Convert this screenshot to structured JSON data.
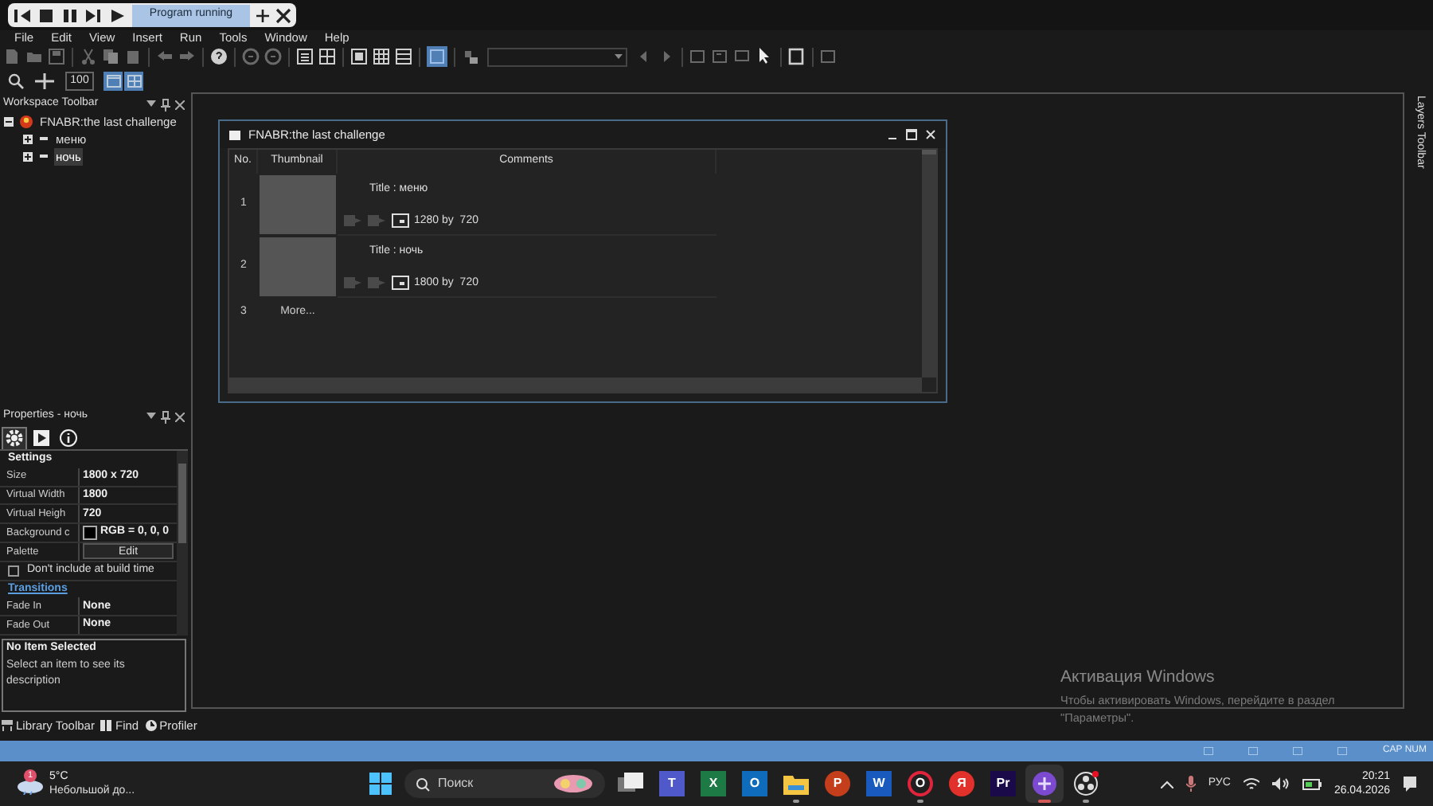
{
  "runner_toolbar": {
    "status": "Program running"
  },
  "menu": [
    "File",
    "Edit",
    "View",
    "Insert",
    "Run",
    "Tools",
    "Window",
    "Help"
  ],
  "toolbar": {
    "layout_toggle_selected": true,
    "zoom": "100",
    "view_toggles": [
      {
        "selected": true
      },
      {
        "selected": true
      }
    ]
  },
  "workspace": {
    "title": "Workspace Toolbar",
    "tree": [
      {
        "label": "FNABR:the last challenge",
        "expanded": true,
        "children": [
          {
            "label": "меню",
            "selected": false
          },
          {
            "label": "ночь",
            "selected": true
          }
        ]
      }
    ]
  },
  "properties": {
    "title": "Properties - ночь",
    "tabs": [
      {
        "kind": "settings",
        "selected": true
      },
      {
        "kind": "events",
        "selected": false
      },
      {
        "kind": "about",
        "selected": false
      }
    ],
    "sections": [
      {
        "heading": "Settings",
        "rows": [
          {
            "kind": "value",
            "name": "Size",
            "value": "1800 x 720"
          },
          {
            "kind": "value",
            "name": "Virtual Width",
            "value": "1800"
          },
          {
            "kind": "value",
            "name": "Virtual Heigh",
            "value": "720"
          },
          {
            "kind": "color",
            "name": "Background c",
            "value": "RGB = 0, 0, 0"
          },
          {
            "kind": "button",
            "name": "Palette",
            "value": "Edit"
          },
          {
            "kind": "checkbox",
            "label": "Don't include at build time",
            "checked": false
          }
        ]
      },
      {
        "heading": "Transitions",
        "rows": [
          {
            "kind": "value",
            "name": "Fade In",
            "value": "None"
          },
          {
            "kind": "value",
            "name": "Fade Out",
            "value": "None"
          }
        ]
      }
    ]
  },
  "description": {
    "title": "No Item Selected",
    "text": "Select an item to see its description"
  },
  "bottom_tabs": [
    {
      "kind": "library",
      "label": "Library Toolbar"
    },
    {
      "kind": "find",
      "label": "Find"
    },
    {
      "kind": "profiler",
      "label": "Profiler"
    }
  ],
  "frames_window": {
    "title": "FNABR:the last challenge",
    "columns": [
      "No.",
      "Thumbnail",
      "Comments"
    ],
    "rows": [
      {
        "kind": "frame",
        "number": "1",
        "title": "Title : меню",
        "size": "1280 by  720"
      },
      {
        "kind": "frame",
        "number": "2",
        "title": "Title : ночь",
        "size": "1800 by  720"
      },
      {
        "kind": "more",
        "number": "3",
        "label": "More..."
      }
    ]
  },
  "layers_toolbar": "Layers Toolbar",
  "activation": {
    "title": "Активация Windows",
    "text": "Чтобы активировать Windows, перейдите в раздел \"Параметры\"."
  },
  "status_bar": {
    "indicators": "CAP NUM"
  },
  "taskbar": {
    "weather": {
      "badge": "1",
      "temperature": "5°C",
      "forecast": "Небольшой до..."
    },
    "search": {
      "placeholder": "Поиск"
    },
    "apps": [
      {
        "kind": "taskview",
        "running": false,
        "active": false
      },
      {
        "kind": "teams",
        "glyph": "T",
        "running": false,
        "active": false
      },
      {
        "kind": "excel",
        "glyph": "X",
        "running": false,
        "active": false
      },
      {
        "kind": "outlook",
        "glyph": "O",
        "running": false,
        "active": false
      },
      {
        "kind": "explorer",
        "running": true,
        "active": false
      },
      {
        "kind": "powerpoint",
        "glyph": "P",
        "running": false,
        "active": false
      },
      {
        "kind": "word",
        "glyph": "W",
        "running": false,
        "active": false
      },
      {
        "kind": "opera",
        "glyph": "O",
        "running": true,
        "active": false
      },
      {
        "kind": "yandex",
        "glyph": "Я",
        "running": false,
        "active": false
      },
      {
        "kind": "premiere",
        "glyph": "Pr",
        "running": false,
        "active": false
      },
      {
        "kind": "fusion",
        "running": true,
        "active": true
      },
      {
        "kind": "obs",
        "running": true,
        "active": false
      }
    ],
    "tray": {
      "language": "РУС",
      "time": "20:21",
      "date": "26.04.2026"
    }
  }
}
